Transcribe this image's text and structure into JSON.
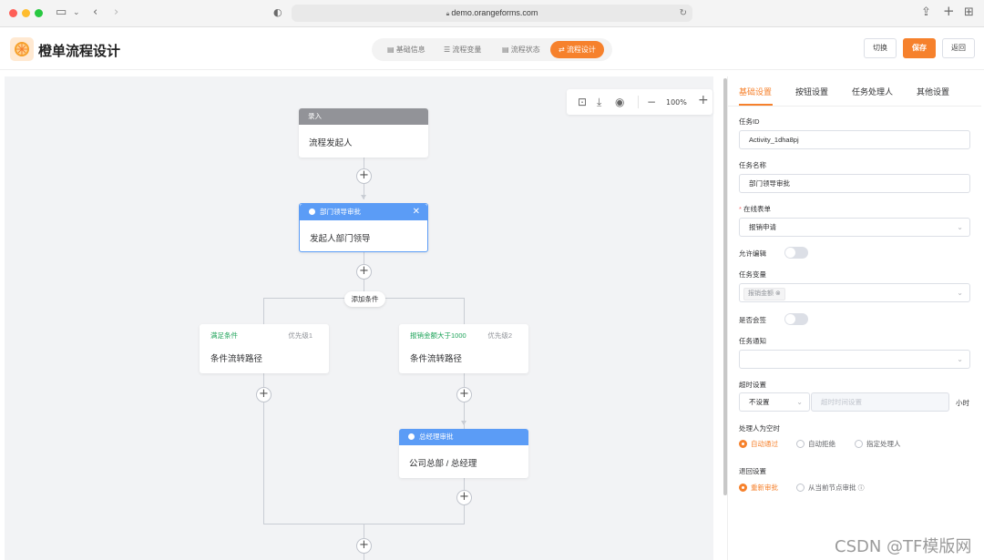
{
  "browser": {
    "url": "demo.orangeforms.com"
  },
  "app": {
    "title": "橙单流程设计"
  },
  "tabs": [
    {
      "label": "基础信息",
      "icon": "document-icon"
    },
    {
      "label": "流程变量",
      "icon": "list-icon"
    },
    {
      "label": "流程状态",
      "icon": "document-icon"
    },
    {
      "label": "流程设计",
      "icon": "flow-icon",
      "active": true
    }
  ],
  "header_buttons": {
    "switch": "切换",
    "save": "保存",
    "back": "返回"
  },
  "toolbar": {
    "zoom": "100%"
  },
  "flow": {
    "start": {
      "head": "录入",
      "body": "流程发起人"
    },
    "dept": {
      "head": "部门领导审批",
      "body": "发起人部门领导"
    },
    "add_condition": "添加条件",
    "cond1": {
      "title": "满足条件",
      "priority": "优先级1",
      "body": "条件流转路径"
    },
    "cond2": {
      "title": "报销金额大于1000",
      "priority": "优先级2",
      "body": "条件流转路径"
    },
    "gm": {
      "head": "总经理审批",
      "body": "公司总部 / 总经理"
    }
  },
  "panel": {
    "tabs": [
      "基础设置",
      "按钮设置",
      "任务处理人",
      "其他设置"
    ],
    "task_id_label": "任务ID",
    "task_id": "Activity_1dha8pj",
    "task_name_label": "任务名称",
    "task_name": "部门领导审批",
    "form_label": "在线表单",
    "form_value": "报销申请",
    "allow_edit_label": "允许编辑",
    "variables_label": "任务变量",
    "variable_tag": "报销金额",
    "countersign_label": "是否会签",
    "notify_label": "任务通知",
    "timeout_label": "超时设置",
    "timeout_value": "不设置",
    "timeout_placeholder": "超时时间设置",
    "timeout_unit": "小时",
    "empty_label": "处理人为空时",
    "empty_options": [
      "自动通过",
      "自动拒绝",
      "指定处理人"
    ],
    "reject_label": "退回设置",
    "reject_options": [
      "重新审批",
      "从当前节点审批"
    ]
  },
  "watermark": "CSDN @TF模版网",
  "colors": {
    "accent": "#f6812c",
    "node_blue": "#5b9cf6",
    "condition_green": "#20a45b"
  }
}
